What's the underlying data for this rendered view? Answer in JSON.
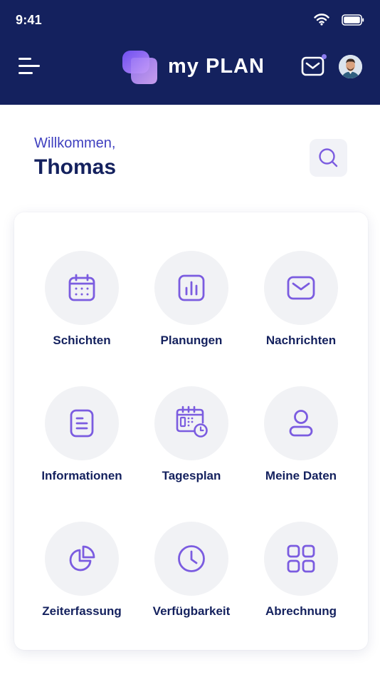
{
  "status_bar": {
    "time": "9:41",
    "icons": [
      "wifi-icon",
      "battery-icon"
    ]
  },
  "header": {
    "menu_icon": "menu-icon",
    "logo_text": "my PLAN",
    "mail_icon": "mail-icon",
    "avatar": "avatar"
  },
  "greeting": {
    "label": "Willkommen,",
    "name": "Thomas"
  },
  "search": {
    "icon": "search-icon"
  },
  "grid": {
    "items": [
      {
        "label": "Schichten",
        "icon": "calendar-icon"
      },
      {
        "label": "Planungen",
        "icon": "bar-chart-icon"
      },
      {
        "label": "Nachrichten",
        "icon": "mail-icon"
      },
      {
        "label": "Informationen",
        "icon": "document-icon"
      },
      {
        "label": "Tagesplan",
        "icon": "calendar-clock-icon"
      },
      {
        "label": "Meine Daten",
        "icon": "user-icon"
      },
      {
        "label": "Zeiterfassung",
        "icon": "pie-chart-icon"
      },
      {
        "label": "Verfügbarkeit",
        "icon": "clock-icon"
      },
      {
        "label": "Abrechnung",
        "icon": "grid-icon"
      }
    ]
  },
  "colors": {
    "header_bg": "#14215e",
    "accent": "#7b5ce0",
    "welcome": "#3f40bf",
    "text_dark": "#14215e",
    "tile_bg": "#f1f2f5"
  }
}
